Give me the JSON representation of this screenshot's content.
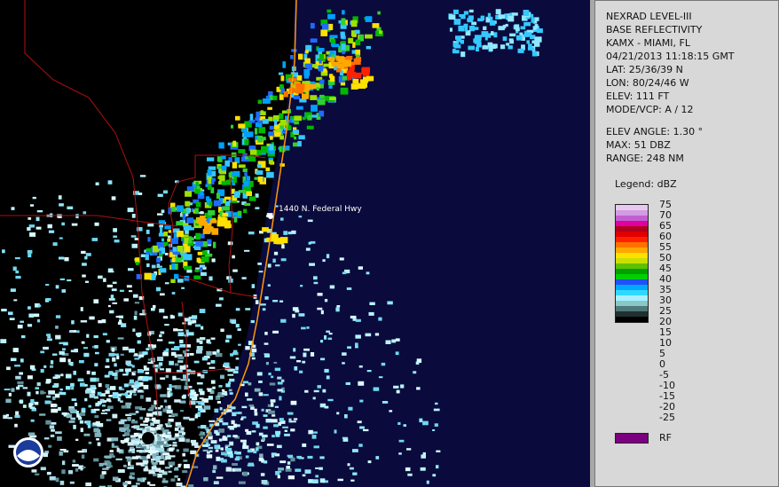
{
  "map": {
    "place_label": "1440 N. Federal Hwy"
  },
  "panel": {
    "lines": [
      "NEXRAD LEVEL-III",
      "BASE REFLECTIVITY",
      "KAMX - MIAMI, FL",
      "04/21/2013 11:18:15 GMT",
      "LAT: 25/36/39 N",
      "LON: 80/24/46 W",
      "ELEV: 111 FT",
      "MODE/VCP: A / 12"
    ],
    "lines2": [
      "ELEV ANGLE: 1.30 °",
      "MAX: 51 DBZ",
      "RANGE: 248 NM"
    ],
    "legend_title": "Legend: dBZ",
    "legend_labels": [
      "75",
      "70",
      "65",
      "60",
      "55",
      "50",
      "45",
      "40",
      "35",
      "30",
      "25",
      "20",
      "15",
      "10",
      "5",
      "0",
      "-5",
      "-10",
      "-15",
      "-20",
      "-25"
    ],
    "legend_colors": [
      "#e8c8f0",
      "#d39be2",
      "#c060d0",
      "#e000a0",
      "#b0001c",
      "#e00000",
      "#ff2000",
      "#ff7000",
      "#ffa800",
      "#ffe000",
      "#c8e000",
      "#60c000",
      "#00a000",
      "#00d000",
      "#2050ff",
      "#00a8ff",
      "#30d8ff",
      "#a8f0ff",
      "#88c8c8",
      "#507878",
      "#203030",
      "#000000"
    ],
    "rf_label": "RF",
    "rf_color": "#7a0080"
  },
  "colors": {
    "ocean": "#0a0a3c",
    "land": "#000000",
    "highway": "#ff9a00",
    "county_lines": "#b01010"
  }
}
